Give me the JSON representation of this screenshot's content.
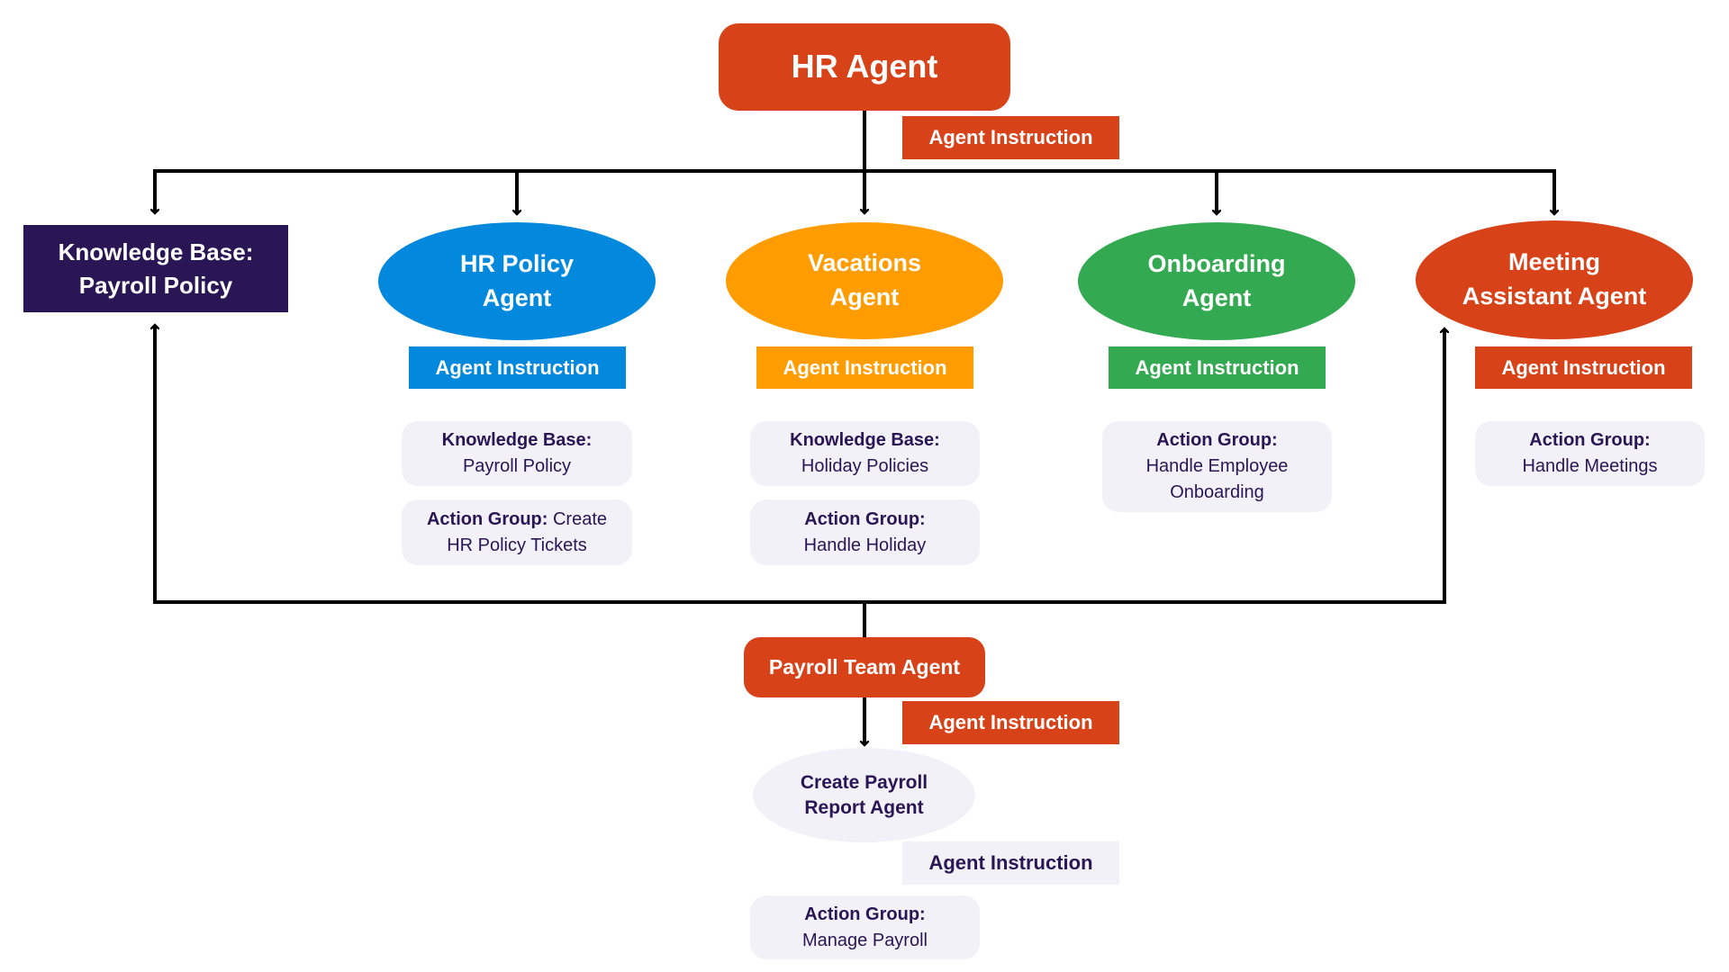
{
  "colors": {
    "hr_agent": "#d84219",
    "knowledge_base": "#2a1654",
    "hr_policy": "#0289de",
    "vacations": "#ff9c00",
    "onboarding": "#33aa51",
    "meeting": "#d84219",
    "payroll": "#d84219",
    "card_bg": "#f2f1f7",
    "card_text": "#2a1654",
    "connector": "#000000"
  },
  "root": {
    "title": "HR Agent",
    "instruction": "Agent Instruction"
  },
  "knowledge_base": {
    "line1": "Knowledge Base:",
    "line2": "Payroll Policy"
  },
  "agents": [
    {
      "line1": "HR Policy",
      "line2": "Agent",
      "instruction": "Agent Instruction",
      "cards": [
        {
          "label": "Knowledge Base:",
          "value": "Payroll Policy"
        },
        {
          "label": "Action Group:",
          "value_inline": "Create",
          "value": "HR Policy Tickets"
        }
      ]
    },
    {
      "line1": "Vacations",
      "line2": "Agent",
      "instruction": "Agent Instruction",
      "cards": [
        {
          "label": "Knowledge Base:",
          "value": "Holiday Policies"
        },
        {
          "label": "Action Group:",
          "value": "Handle Holiday"
        }
      ]
    },
    {
      "line1": "Onboarding",
      "line2": "Agent",
      "instruction": "Agent Instruction",
      "cards": [
        {
          "label": "Action Group:",
          "value": "Handle Employee",
          "value2": "Onboarding"
        }
      ]
    },
    {
      "line1": "Meeting",
      "line2": "Assistant Agent",
      "instruction": "Agent Instruction",
      "cards": [
        {
          "label": "Action Group:",
          "value": "Handle Meetings"
        }
      ]
    }
  ],
  "payroll_team": {
    "title": "Payroll Team Agent",
    "instruction": "Agent Instruction"
  },
  "sub_agent": {
    "line1": "Create Payroll",
    "line2": "Report Agent",
    "instruction": "Agent Instruction",
    "card": {
      "label": "Action Group:",
      "value": "Manage Payroll"
    }
  }
}
